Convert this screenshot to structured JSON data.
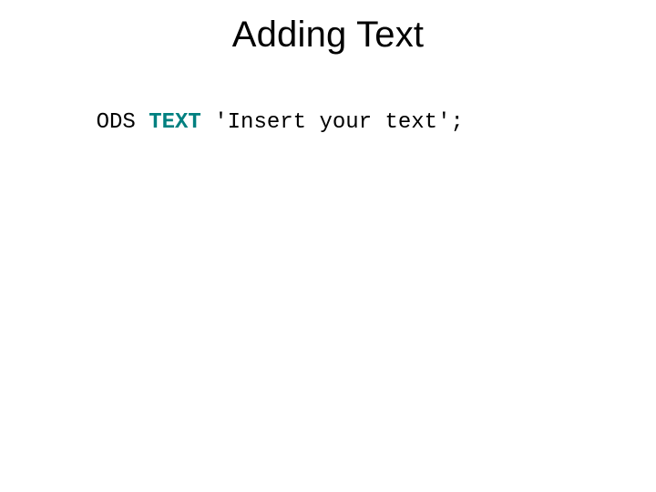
{
  "title": "Adding Text",
  "code": {
    "prefix": "ODS ",
    "keyword": "TEXT",
    "rest": " 'Insert your text';"
  }
}
